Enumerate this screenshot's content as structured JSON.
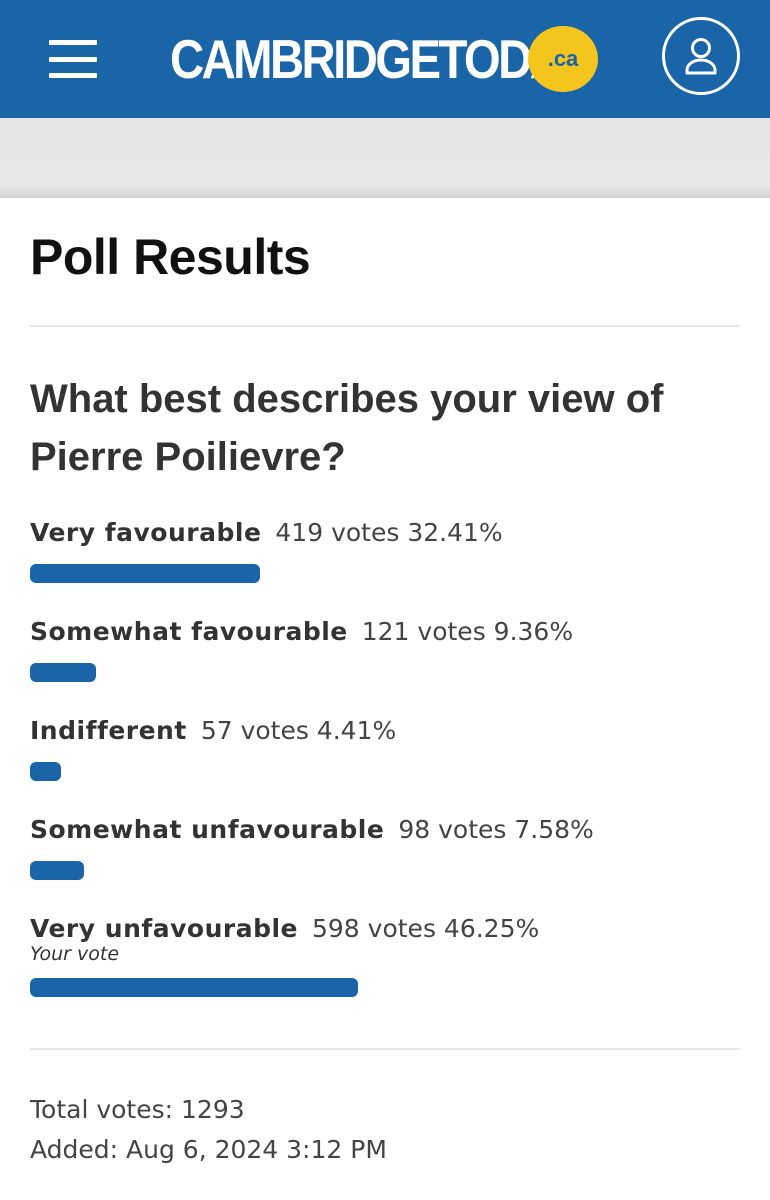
{
  "header": {
    "logo_text": "CAMBRIDGETODAY",
    "logo_badge": ".ca",
    "menu_icon": "hamburger-menu-icon",
    "account_icon": "user-account-icon",
    "brand_color": "#1a64a8",
    "badge_color": "#f4c51c"
  },
  "page": {
    "title": "Poll Results"
  },
  "poll": {
    "question": "What best describes your view of Pierre Poilievre?",
    "options": [
      {
        "label": "Very favourable",
        "votes": "419 votes",
        "percent": "32.41%",
        "share": 32.41,
        "note": ""
      },
      {
        "label": "Somewhat favourable",
        "votes": "121 votes",
        "percent": "9.36%",
        "share": 9.36,
        "note": ""
      },
      {
        "label": "Indifferent",
        "votes": "57 votes",
        "percent": "4.41%",
        "share": 4.41,
        "note": ""
      },
      {
        "label": "Somewhat unfavourable",
        "votes": "98 votes",
        "percent": "7.58%",
        "share": 7.58,
        "note": ""
      },
      {
        "label": "Very unfavourable",
        "votes": "598 votes",
        "percent": "46.25%",
        "share": 46.25,
        "note": "Your vote"
      }
    ],
    "total_votes": "Total votes: 1293",
    "added": "Added: Aug 6, 2024 3:12 PM"
  }
}
